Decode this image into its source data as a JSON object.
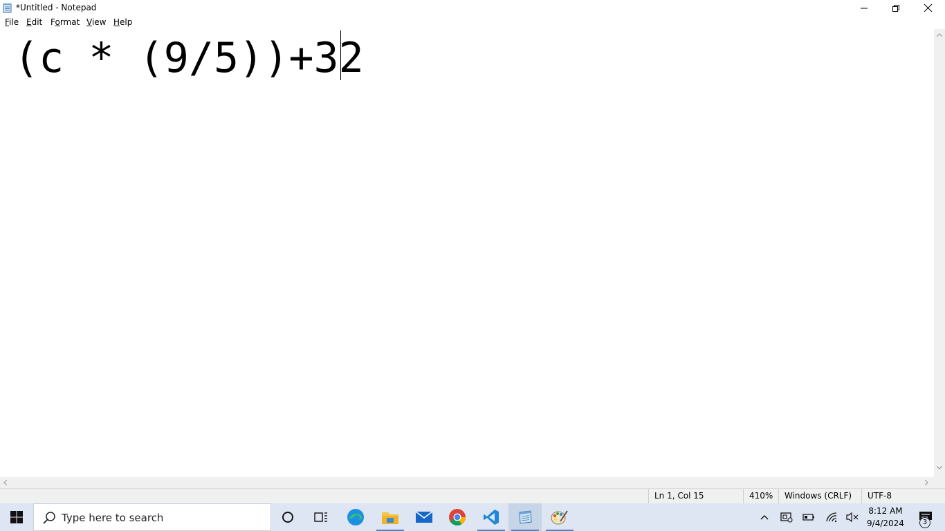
{
  "window": {
    "title": "*Untitled - Notepad"
  },
  "menu": {
    "items": [
      {
        "accel": "F",
        "rest": "ile"
      },
      {
        "accel": "E",
        "rest": "dit"
      },
      {
        "accel": "F",
        "rest": "ormat",
        "prefix": ""
      },
      {
        "accel": "V",
        "rest": "iew"
      },
      {
        "accel": "H",
        "rest": "elp"
      }
    ]
  },
  "editor": {
    "content": "(c * (9/5))+32"
  },
  "status": {
    "position": "Ln 1, Col 15",
    "zoom": "410%",
    "line_endings": "Windows (CRLF)",
    "encoding": "UTF-8"
  },
  "taskbar": {
    "search_placeholder": "Type here to search",
    "pinned": [
      "cortana-icon",
      "task-view-icon",
      "edge-icon",
      "file-explorer-icon",
      "mail-icon",
      "chrome-icon",
      "vscode-icon",
      "notepad-icon",
      "paint-icon"
    ],
    "clock_time": "8:12 AM",
    "clock_date": "9/4/2024",
    "notification_count": "3"
  },
  "colors": {
    "taskbar_bg": "#dde6f2",
    "accent": "#4a85c8"
  }
}
